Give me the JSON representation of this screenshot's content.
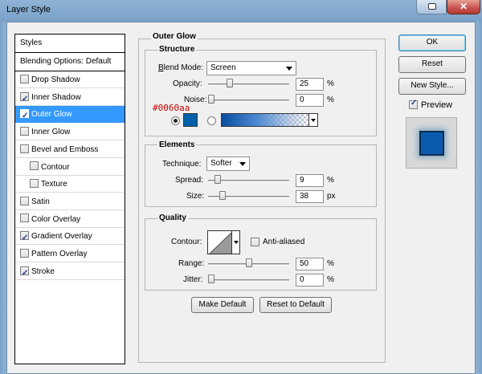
{
  "window": {
    "title": "Layer Style"
  },
  "styles_list": {
    "header": "Styles",
    "blending": "Blending Options: Default",
    "items": [
      {
        "label": "Drop Shadow",
        "checked": false
      },
      {
        "label": "Inner Shadow",
        "checked": true
      },
      {
        "label": "Outer Glow",
        "checked": true,
        "selected": true
      },
      {
        "label": "Inner Glow",
        "checked": false
      },
      {
        "label": "Bevel and Emboss",
        "checked": false
      },
      {
        "label": "Contour",
        "checked": false,
        "indent": true
      },
      {
        "label": "Texture",
        "checked": false,
        "indent": true
      },
      {
        "label": "Satin",
        "checked": false
      },
      {
        "label": "Color Overlay",
        "checked": false
      },
      {
        "label": "Gradient Overlay",
        "checked": true
      },
      {
        "label": "Pattern Overlay",
        "checked": false
      },
      {
        "label": "Stroke",
        "checked": true
      }
    ]
  },
  "outer_glow": {
    "title": "Outer Glow",
    "structure": {
      "title": "Structure",
      "blend_mode_label": "Blend Mode:",
      "blend_mode": "Screen",
      "opacity_label": "Opacity:",
      "opacity": "25",
      "opacity_level": 0.25,
      "noise_label": "Noise:",
      "noise": "0",
      "noise_level": 0,
      "percent": "%",
      "glow_color": "#0060aa",
      "color_annotation": "#0060aa"
    },
    "elements": {
      "title": "Elements",
      "technique_label": "Technique:",
      "technique": "Softer",
      "spread_label": "Spread:",
      "spread": "9",
      "spread_level": 0.09,
      "size_label": "Size:",
      "size": "38",
      "size_level": 0.15,
      "percent": "%",
      "px": "px"
    },
    "quality": {
      "title": "Quality",
      "contour_label": "Contour:",
      "anti_aliased_label": "Anti-aliased",
      "range_label": "Range:",
      "range": "50",
      "range_level": 0.5,
      "jitter_label": "Jitter:",
      "jitter": "0",
      "jitter_level": 0,
      "percent": "%"
    },
    "make_default": "Make Default",
    "reset_default": "Reset to Default"
  },
  "buttons": {
    "ok": "OK",
    "reset": "Reset",
    "new_style": "New Style...",
    "preview_label": "Preview"
  },
  "colors": {
    "accent": "#3399ff",
    "glow": "#0060aa"
  }
}
